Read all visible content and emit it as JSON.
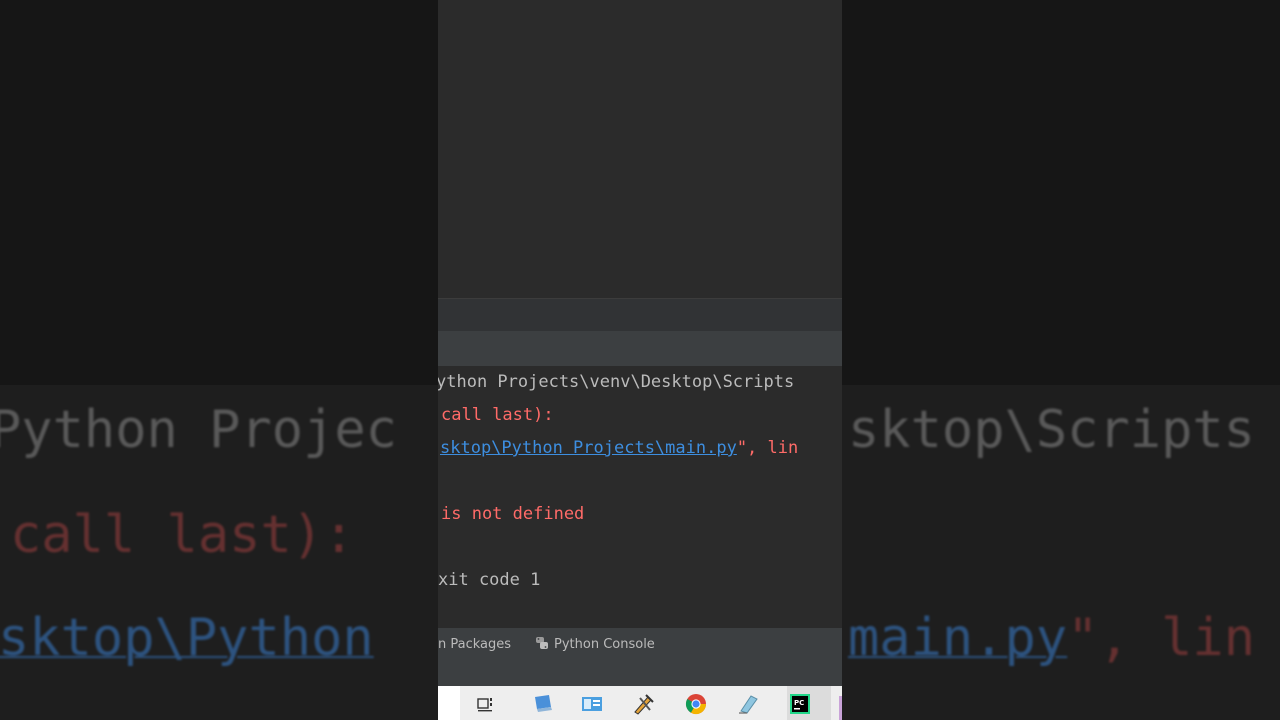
{
  "background": {
    "line1_left": "Python Projec",
    "line1_right": "sktop\\Scripts",
    "line2": "call last):",
    "line3_left": "sktop\\Python",
    "line3_right_link": "main.py",
    "line3_right_tail": "\", lin"
  },
  "console": {
    "line1": "ython Projects\\venv\\Desktop\\Scripts",
    "line2": "call last):",
    "line3_link": "sktop\\Python Projects\\main.py",
    "line3_tail": "\", lin",
    "line4": "is not defined",
    "line5": "xit code 1"
  },
  "toolstrip": {
    "packages_label": "n Packages",
    "python_console_label": "Python Console"
  },
  "taskbar": {
    "icons": [
      "task-view-icon",
      "computer-icon",
      "control-panel-icon",
      "tools-icon",
      "chrome-icon",
      "notepad-icon",
      "pycharm-icon"
    ],
    "pycharm_label": "PC"
  },
  "colors": {
    "panel_bg": "#2b2b2b",
    "error_red": "#ff6b68",
    "link_blue": "#3d8ee0",
    "text_gray": "#bbbbbb"
  }
}
